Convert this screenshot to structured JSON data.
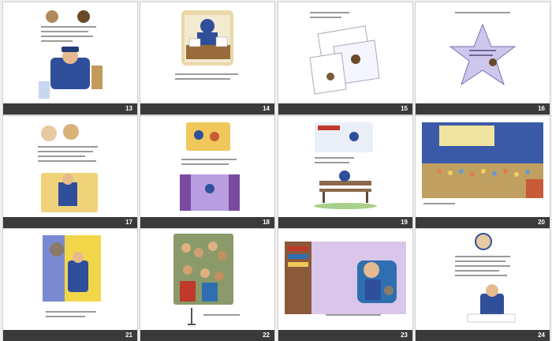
{
  "slides": [
    {
      "number": "13"
    },
    {
      "number": "14"
    },
    {
      "number": "15"
    },
    {
      "number": "16"
    },
    {
      "number": "17"
    },
    {
      "number": "18"
    },
    {
      "number": "19"
    },
    {
      "number": "20"
    },
    {
      "number": "21"
    },
    {
      "number": "22"
    },
    {
      "number": "23"
    },
    {
      "number": "24"
    }
  ],
  "colors": {
    "background": "#efefef",
    "slide": "#ffffff",
    "number_bar": "#3a3a3a",
    "number_text": "#ffffff"
  }
}
